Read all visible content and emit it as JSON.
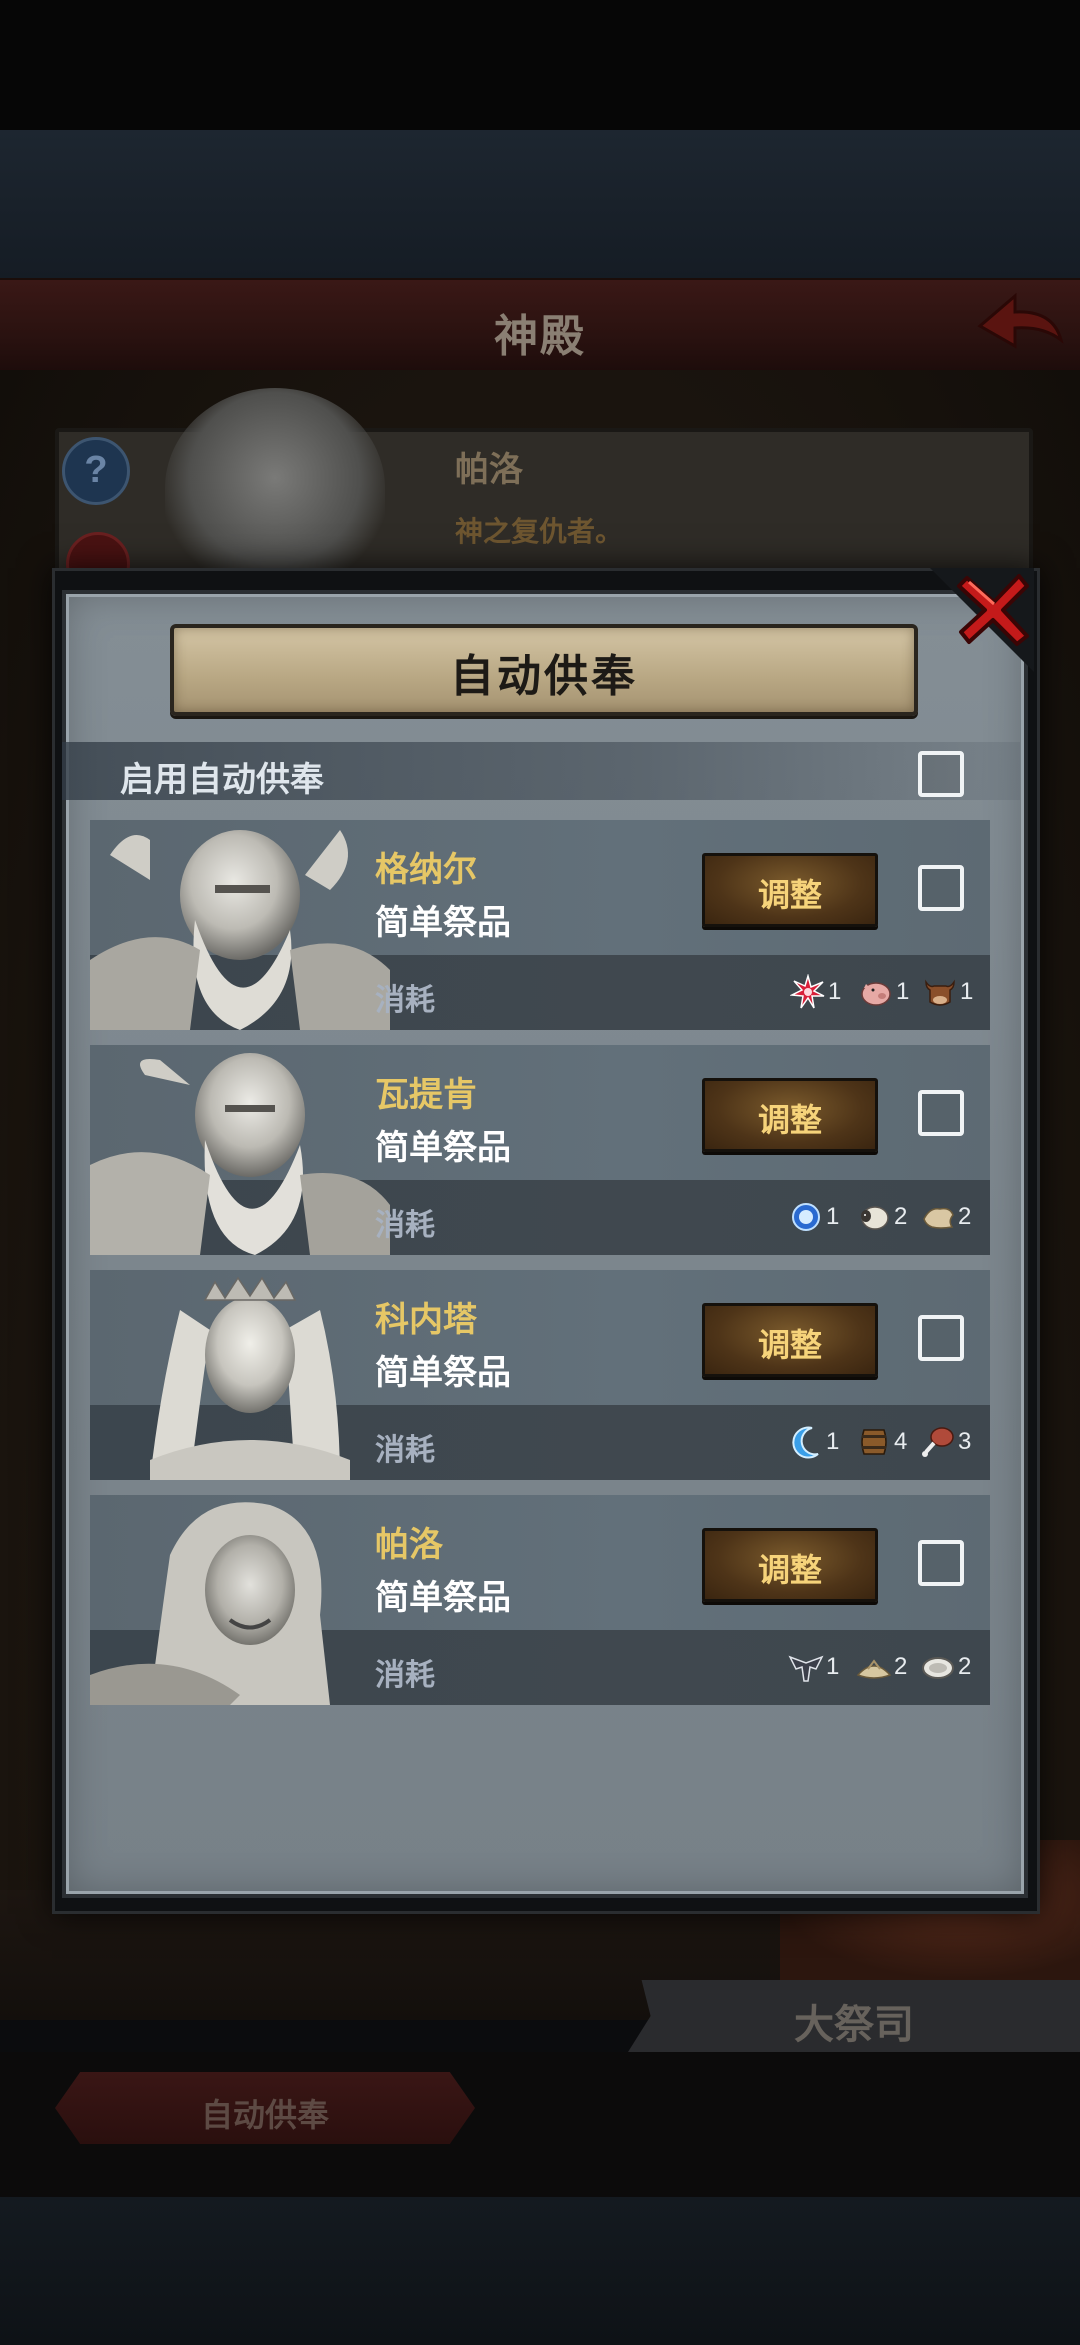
{
  "background": {
    "title": "神殿",
    "hero": {
      "name": "帕洛",
      "description": "神之复仇者。"
    },
    "bottom_tab": "大祭司",
    "bottom_button": "自动供奉",
    "help_icon": "question-icon"
  },
  "dialog": {
    "title": "自动供奉",
    "enable_label": "启用自动供奉",
    "enable_checked": false,
    "consume_label": "消耗",
    "adjust_label": "调整",
    "gods": [
      {
        "name": "格纳尔",
        "offering": "简单祭品",
        "checked": false,
        "resources": [
          {
            "icon": "red-burst-icon",
            "count": "1"
          },
          {
            "icon": "pig-icon",
            "count": "1"
          },
          {
            "icon": "cow-icon",
            "count": "1"
          }
        ]
      },
      {
        "name": "瓦提肯",
        "offering": "简单祭品",
        "checked": false,
        "resources": [
          {
            "icon": "blue-orb-icon",
            "count": "1"
          },
          {
            "icon": "sheep-icon",
            "count": "2"
          },
          {
            "icon": "leather-icon",
            "count": "2"
          }
        ]
      },
      {
        "name": "科内塔",
        "offering": "简单祭品",
        "checked": false,
        "resources": [
          {
            "icon": "blue-crescent-icon",
            "count": "1"
          },
          {
            "icon": "barrel-icon",
            "count": "4"
          },
          {
            "icon": "meat-leg-icon",
            "count": "3"
          }
        ]
      },
      {
        "name": "帕洛",
        "offering": "简单祭品",
        "checked": false,
        "resources": [
          {
            "icon": "dark-emblem-icon",
            "count": "1"
          },
          {
            "icon": "grain-icon",
            "count": "2"
          },
          {
            "icon": "fish-icon",
            "count": "2"
          }
        ]
      }
    ]
  },
  "colors": {
    "accent_gold": "#e6c766",
    "button_text": "#f6d37a",
    "close_red": "#c41a1a"
  }
}
